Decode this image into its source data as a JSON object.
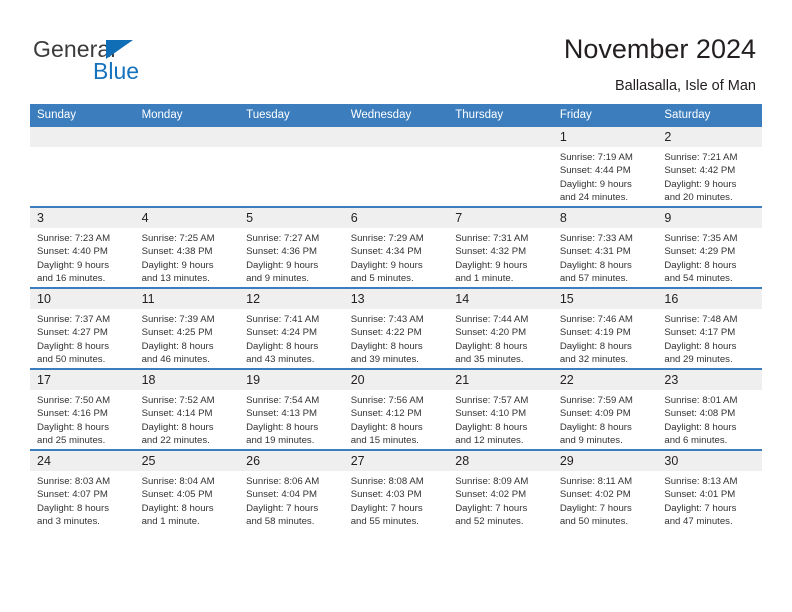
{
  "brand": {
    "name_part1": "General",
    "name_part2": "Blue"
  },
  "header": {
    "title": "November 2024",
    "subtitle": "Ballasalla, Isle of Man"
  },
  "colors": {
    "header_blue": "#3b7dbd",
    "brand_blue": "#1573be",
    "daynum_band": "#efefef"
  },
  "weekday_headers": [
    "Sunday",
    "Monday",
    "Tuesday",
    "Wednesday",
    "Thursday",
    "Friday",
    "Saturday"
  ],
  "weeks": [
    [
      {
        "day": "",
        "lines": []
      },
      {
        "day": "",
        "lines": []
      },
      {
        "day": "",
        "lines": []
      },
      {
        "day": "",
        "lines": []
      },
      {
        "day": "",
        "lines": []
      },
      {
        "day": "1",
        "lines": [
          "Sunrise: 7:19 AM",
          "Sunset: 4:44 PM",
          "Daylight: 9 hours",
          "and 24 minutes."
        ]
      },
      {
        "day": "2",
        "lines": [
          "Sunrise: 7:21 AM",
          "Sunset: 4:42 PM",
          "Daylight: 9 hours",
          "and 20 minutes."
        ]
      }
    ],
    [
      {
        "day": "3",
        "lines": [
          "Sunrise: 7:23 AM",
          "Sunset: 4:40 PM",
          "Daylight: 9 hours",
          "and 16 minutes."
        ]
      },
      {
        "day": "4",
        "lines": [
          "Sunrise: 7:25 AM",
          "Sunset: 4:38 PM",
          "Daylight: 9 hours",
          "and 13 minutes."
        ]
      },
      {
        "day": "5",
        "lines": [
          "Sunrise: 7:27 AM",
          "Sunset: 4:36 PM",
          "Daylight: 9 hours",
          "and 9 minutes."
        ]
      },
      {
        "day": "6",
        "lines": [
          "Sunrise: 7:29 AM",
          "Sunset: 4:34 PM",
          "Daylight: 9 hours",
          "and 5 minutes."
        ]
      },
      {
        "day": "7",
        "lines": [
          "Sunrise: 7:31 AM",
          "Sunset: 4:32 PM",
          "Daylight: 9 hours",
          "and 1 minute."
        ]
      },
      {
        "day": "8",
        "lines": [
          "Sunrise: 7:33 AM",
          "Sunset: 4:31 PM",
          "Daylight: 8 hours",
          "and 57 minutes."
        ]
      },
      {
        "day": "9",
        "lines": [
          "Sunrise: 7:35 AM",
          "Sunset: 4:29 PM",
          "Daylight: 8 hours",
          "and 54 minutes."
        ]
      }
    ],
    [
      {
        "day": "10",
        "lines": [
          "Sunrise: 7:37 AM",
          "Sunset: 4:27 PM",
          "Daylight: 8 hours",
          "and 50 minutes."
        ]
      },
      {
        "day": "11",
        "lines": [
          "Sunrise: 7:39 AM",
          "Sunset: 4:25 PM",
          "Daylight: 8 hours",
          "and 46 minutes."
        ]
      },
      {
        "day": "12",
        "lines": [
          "Sunrise: 7:41 AM",
          "Sunset: 4:24 PM",
          "Daylight: 8 hours",
          "and 43 minutes."
        ]
      },
      {
        "day": "13",
        "lines": [
          "Sunrise: 7:43 AM",
          "Sunset: 4:22 PM",
          "Daylight: 8 hours",
          "and 39 minutes."
        ]
      },
      {
        "day": "14",
        "lines": [
          "Sunrise: 7:44 AM",
          "Sunset: 4:20 PM",
          "Daylight: 8 hours",
          "and 35 minutes."
        ]
      },
      {
        "day": "15",
        "lines": [
          "Sunrise: 7:46 AM",
          "Sunset: 4:19 PM",
          "Daylight: 8 hours",
          "and 32 minutes."
        ]
      },
      {
        "day": "16",
        "lines": [
          "Sunrise: 7:48 AM",
          "Sunset: 4:17 PM",
          "Daylight: 8 hours",
          "and 29 minutes."
        ]
      }
    ],
    [
      {
        "day": "17",
        "lines": [
          "Sunrise: 7:50 AM",
          "Sunset: 4:16 PM",
          "Daylight: 8 hours",
          "and 25 minutes."
        ]
      },
      {
        "day": "18",
        "lines": [
          "Sunrise: 7:52 AM",
          "Sunset: 4:14 PM",
          "Daylight: 8 hours",
          "and 22 minutes."
        ]
      },
      {
        "day": "19",
        "lines": [
          "Sunrise: 7:54 AM",
          "Sunset: 4:13 PM",
          "Daylight: 8 hours",
          "and 19 minutes."
        ]
      },
      {
        "day": "20",
        "lines": [
          "Sunrise: 7:56 AM",
          "Sunset: 4:12 PM",
          "Daylight: 8 hours",
          "and 15 minutes."
        ]
      },
      {
        "day": "21",
        "lines": [
          "Sunrise: 7:57 AM",
          "Sunset: 4:10 PM",
          "Daylight: 8 hours",
          "and 12 minutes."
        ]
      },
      {
        "day": "22",
        "lines": [
          "Sunrise: 7:59 AM",
          "Sunset: 4:09 PM",
          "Daylight: 8 hours",
          "and 9 minutes."
        ]
      },
      {
        "day": "23",
        "lines": [
          "Sunrise: 8:01 AM",
          "Sunset: 4:08 PM",
          "Daylight: 8 hours",
          "and 6 minutes."
        ]
      }
    ],
    [
      {
        "day": "24",
        "lines": [
          "Sunrise: 8:03 AM",
          "Sunset: 4:07 PM",
          "Daylight: 8 hours",
          "and 3 minutes."
        ]
      },
      {
        "day": "25",
        "lines": [
          "Sunrise: 8:04 AM",
          "Sunset: 4:05 PM",
          "Daylight: 8 hours",
          "and 1 minute."
        ]
      },
      {
        "day": "26",
        "lines": [
          "Sunrise: 8:06 AM",
          "Sunset: 4:04 PM",
          "Daylight: 7 hours",
          "and 58 minutes."
        ]
      },
      {
        "day": "27",
        "lines": [
          "Sunrise: 8:08 AM",
          "Sunset: 4:03 PM",
          "Daylight: 7 hours",
          "and 55 minutes."
        ]
      },
      {
        "day": "28",
        "lines": [
          "Sunrise: 8:09 AM",
          "Sunset: 4:02 PM",
          "Daylight: 7 hours",
          "and 52 minutes."
        ]
      },
      {
        "day": "29",
        "lines": [
          "Sunrise: 8:11 AM",
          "Sunset: 4:02 PM",
          "Daylight: 7 hours",
          "and 50 minutes."
        ]
      },
      {
        "day": "30",
        "lines": [
          "Sunrise: 8:13 AM",
          "Sunset: 4:01 PM",
          "Daylight: 7 hours",
          "and 47 minutes."
        ]
      }
    ]
  ]
}
